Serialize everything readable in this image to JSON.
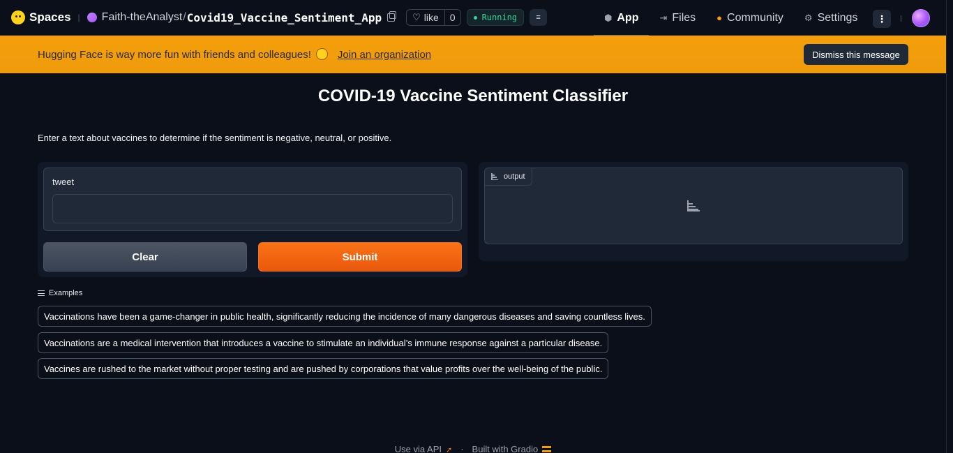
{
  "header": {
    "brand": "Spaces",
    "owner": "Faith-theAnalyst",
    "repo": "Covid19_Vaccine_Sentiment_App",
    "like_label": "like",
    "like_count": "0",
    "status": "Running",
    "tabs": [
      {
        "label": "App",
        "icon": "cube-icon",
        "active": true
      },
      {
        "label": "Files",
        "icon": "files-icon",
        "active": false
      },
      {
        "label": "Community",
        "icon": "community-icon",
        "active": false
      },
      {
        "label": "Settings",
        "icon": "gear-icon",
        "active": false
      }
    ]
  },
  "banner": {
    "text": "Hugging Face is way more fun with friends and colleagues!",
    "link": "Join an organization",
    "dismiss": "Dismiss this message"
  },
  "main": {
    "title": "COVID-19 Vaccine Sentiment Classifier",
    "description": "Enter a text about vaccines to determine if the sentiment is negative, neutral, or positive.",
    "input_label": "tweet",
    "input_value": "",
    "clear_label": "Clear",
    "submit_label": "Submit",
    "output_label": "output"
  },
  "examples": {
    "heading": "Examples",
    "items": [
      "Vaccinations have been a game-changer in public health, significantly reducing the incidence of many dangerous diseases and saving countless lives.",
      "Vaccinations are a medical intervention that introduces a vaccine to stimulate an individual’s immune response against a particular disease.",
      "Vaccines are rushed to the market without proper testing and are pushed by corporations that value profits over the well-being of the public."
    ]
  },
  "footer": {
    "api": "Use via API",
    "sep": "·",
    "built": "Built with Gradio"
  },
  "colors": {
    "background": "#0b0f19",
    "banner": "#f59e0b",
    "submit": "#f97316",
    "status": "#34d399"
  }
}
